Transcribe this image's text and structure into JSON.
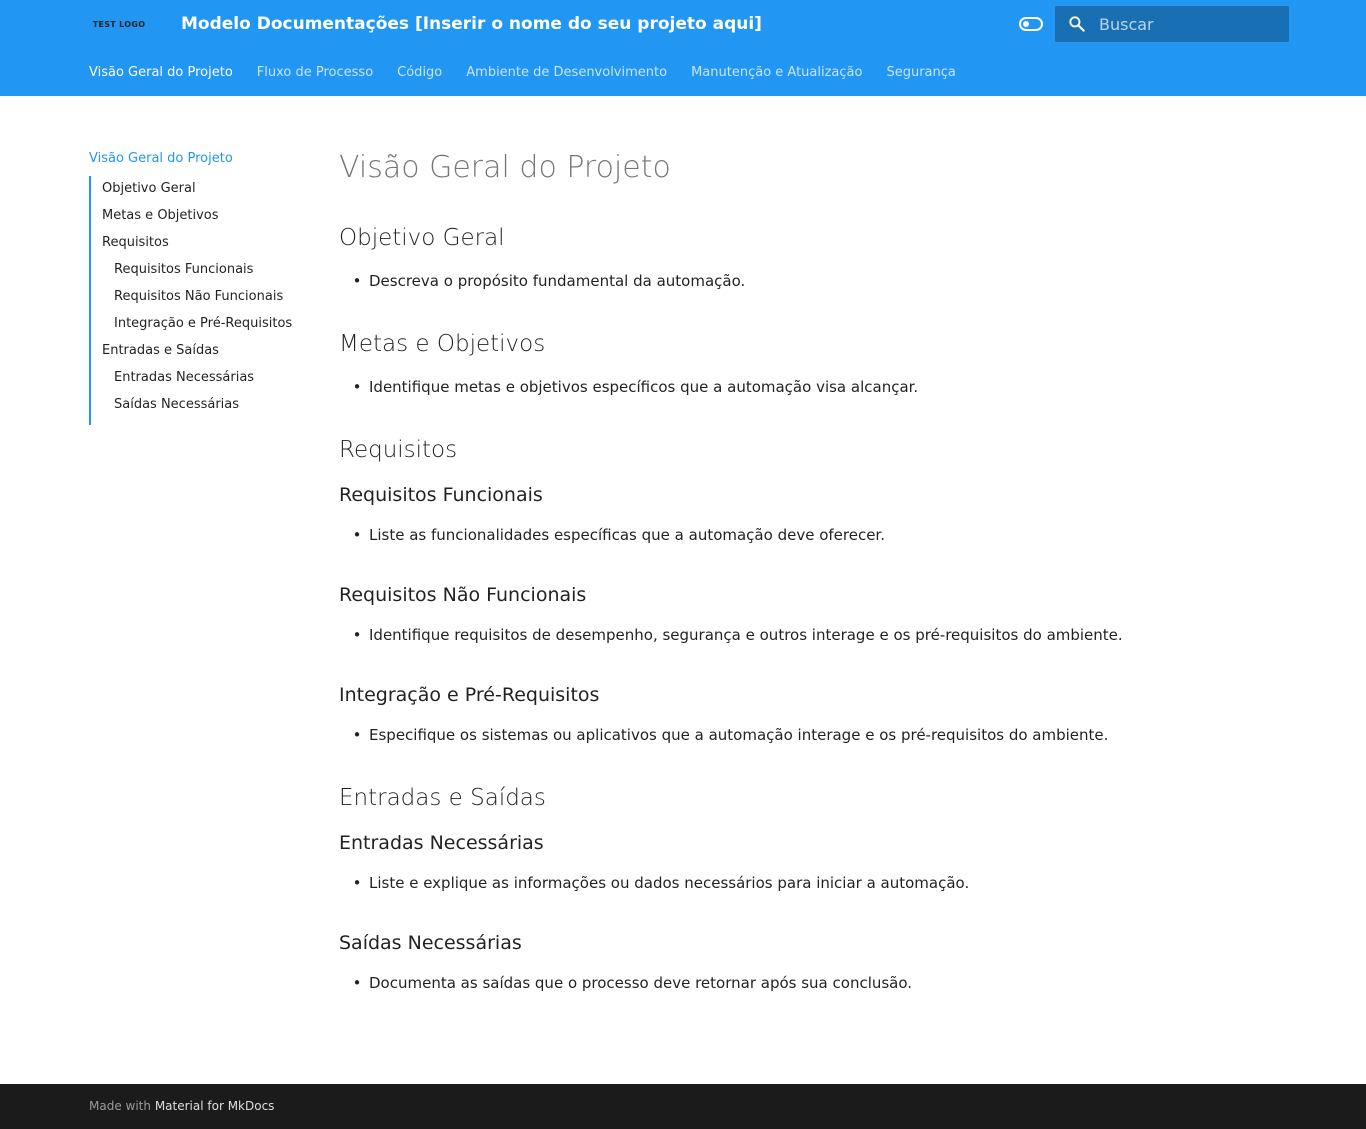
{
  "header": {
    "logo_text": "TEST LOGO",
    "site_title": "Modelo Documentações [Inserir o nome do seu projeto aqui]",
    "search_placeholder": "Buscar",
    "palette_toggle_icon": "toggle-icon",
    "search_icon": "search-icon",
    "colors": {
      "primary": "#2196f3",
      "footer": "#1b1b1b"
    }
  },
  "tabs": [
    {
      "label": "Visão Geral do Projeto",
      "active": true
    },
    {
      "label": "Fluxo de Processo",
      "active": false
    },
    {
      "label": "Código",
      "active": false
    },
    {
      "label": "Ambiente de Desenvolvimento",
      "active": false
    },
    {
      "label": "Manutenção e Atualização",
      "active": false
    },
    {
      "label": "Segurança",
      "active": false
    }
  ],
  "sidebar": {
    "title": "Visão Geral do Projeto",
    "items": [
      {
        "label": "Objetivo Geral",
        "level": 1
      },
      {
        "label": "Metas e Objetivos",
        "level": 1
      },
      {
        "label": "Requisitos",
        "level": 1
      },
      {
        "label": "Requisitos Funcionais",
        "level": 2
      },
      {
        "label": "Requisitos Não Funcionais",
        "level": 2
      },
      {
        "label": "Integração e Pré-Requisitos",
        "level": 2
      },
      {
        "label": "Entradas e Saídas",
        "level": 1
      },
      {
        "label": "Entradas Necessárias",
        "level": 2
      },
      {
        "label": "Saídas Necessárias",
        "level": 2
      }
    ]
  },
  "content": {
    "title": "Visão Geral do Projeto",
    "objetivo_geral": {
      "heading": "Objetivo Geral",
      "bullet": "Descreva o propósito fundamental da automação."
    },
    "metas": {
      "heading": "Metas e Objetivos",
      "bullet": "Identifique metas e objetivos específicos que a automação visa alcançar."
    },
    "requisitos": {
      "heading": "Requisitos",
      "funcionais": {
        "heading": "Requisitos Funcionais",
        "bullet": "Liste as funcionalidades específicas que a automação deve oferecer."
      },
      "nao_funcionais": {
        "heading": "Requisitos Não Funcionais",
        "bullet": "Identifique requisitos de desempenho, segurança e outros interage e os pré-requisitos do ambiente."
      },
      "integracao": {
        "heading": "Integração e Pré-Requisitos",
        "bullet": "Especifique os sistemas ou aplicativos que a automação interage e os pré-requisitos do ambiente."
      }
    },
    "entradas_saidas": {
      "heading": "Entradas e Saídas",
      "entradas": {
        "heading": "Entradas Necessárias",
        "bullet": "Liste e explique as informações ou dados necessários para iniciar a automação."
      },
      "saidas": {
        "heading": "Saídas Necessárias",
        "bullet": "Documenta as saídas que o processo deve retornar após sua conclusão."
      }
    }
  },
  "footer": {
    "made_with": "Made with",
    "link": "Material for MkDocs"
  }
}
